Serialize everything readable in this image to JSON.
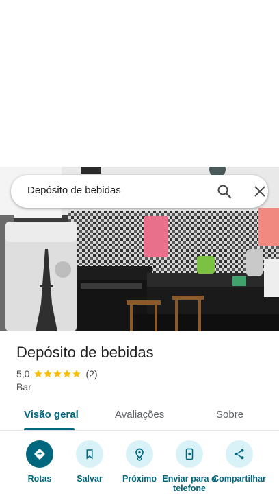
{
  "search": {
    "query": "Depósito de bebidas"
  },
  "place": {
    "name": "Depósito de bebidas",
    "rating": "5,0",
    "stars": 5,
    "review_count": "(2)",
    "category": "Bar"
  },
  "tabs": [
    {
      "label": "Visão geral",
      "active": true
    },
    {
      "label": "Avaliações",
      "active": false
    },
    {
      "label": "Sobre",
      "active": false
    }
  ],
  "actions": [
    {
      "label": "Rotas",
      "icon": "directions-icon"
    },
    {
      "label": "Salvar",
      "icon": "bookmark-icon"
    },
    {
      "label": "Próximo",
      "icon": "nearby-icon"
    },
    {
      "label": "Enviar para o telefone",
      "icon": "send-to-phone-icon"
    },
    {
      "label": "Compartilhar",
      "icon": "share-icon"
    }
  ],
  "colors": {
    "accent": "#00677f",
    "accent_light": "#d9f2f7",
    "star": "#fbbc04"
  }
}
